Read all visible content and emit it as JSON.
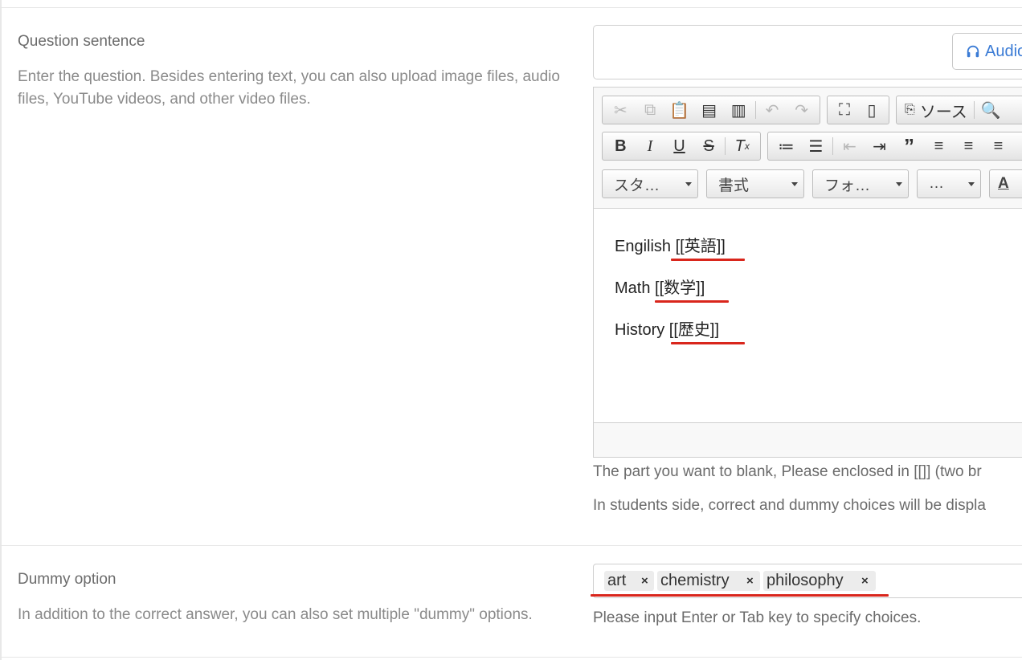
{
  "question": {
    "title": "Question sentence",
    "description": "Enter the question. Besides entering text, you can also upload image files, audio files, YouTube videos, and other video files.",
    "audio_button_label": "Audio",
    "editor": {
      "source_label": "ソース",
      "styles_combo": "スタ…",
      "format_combo": "書式",
      "font_combo": "フォ…",
      "size_combo": "…",
      "lines": [
        "Engilish [[英語]]",
        "Math [[数学]]",
        "History [[歴史]]"
      ]
    },
    "help_1": "The part you want to blank, Please enclosed in [[]] (two br",
    "help_2": "In students side, correct and dummy choices will be displa"
  },
  "dummy": {
    "title": "Dummy option",
    "description": "In addition to the correct answer, you can also set multiple \"dummy\" options.",
    "tags": [
      "art",
      "chemistry",
      "philosophy"
    ],
    "remove_glyph": "×",
    "help": "Please input Enter or Tab key to specify choices."
  },
  "colors": {
    "underline": "#d9261c",
    "link_blue": "#3a7bd5"
  }
}
